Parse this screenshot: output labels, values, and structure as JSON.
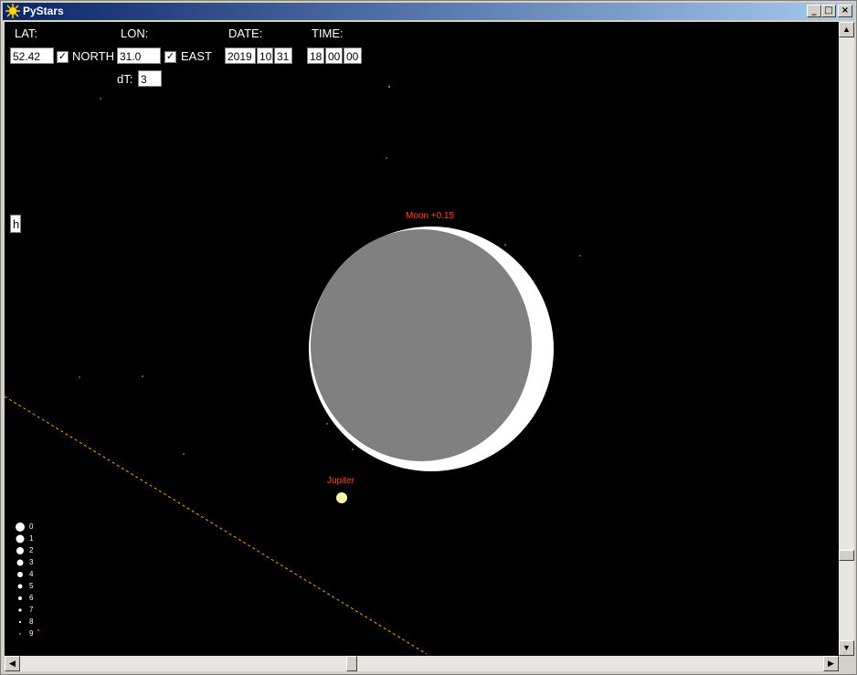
{
  "window": {
    "title": "PyStars",
    "minimize_glyph": "_",
    "maximize_glyph": "□",
    "close_glyph": "×"
  },
  "controls": {
    "lat_label": "LAT:",
    "lat_value": "52.42",
    "north_checked": true,
    "north_label": "NORTH",
    "lon_label": "LON:",
    "lon_value": "31.0",
    "east_checked": true,
    "east_label": "EAST",
    "dt_label": "dT:",
    "dt_value": "3",
    "date_label": "DATE:",
    "date_year": "2019",
    "date_month": "10",
    "date_day": "31",
    "time_label": "TIME:",
    "time_hour": "18",
    "time_minute": "00",
    "time_second": "00",
    "h_button": "h"
  },
  "sky": {
    "moon_label": "Moon +0.15",
    "jupiter_label": "Jupiter",
    "label_color": "#ff4a1c",
    "ecliptic_color": "#ffa500"
  },
  "legend": {
    "magnitudes": [
      "0",
      "1",
      "2",
      "3",
      "4",
      "5",
      "6",
      "7",
      "8",
      "9"
    ]
  },
  "colors": {
    "sky": "#000000",
    "moon_lit": "#ffffff",
    "moon_dark": "#808080",
    "titlebar": "#0a246a"
  }
}
